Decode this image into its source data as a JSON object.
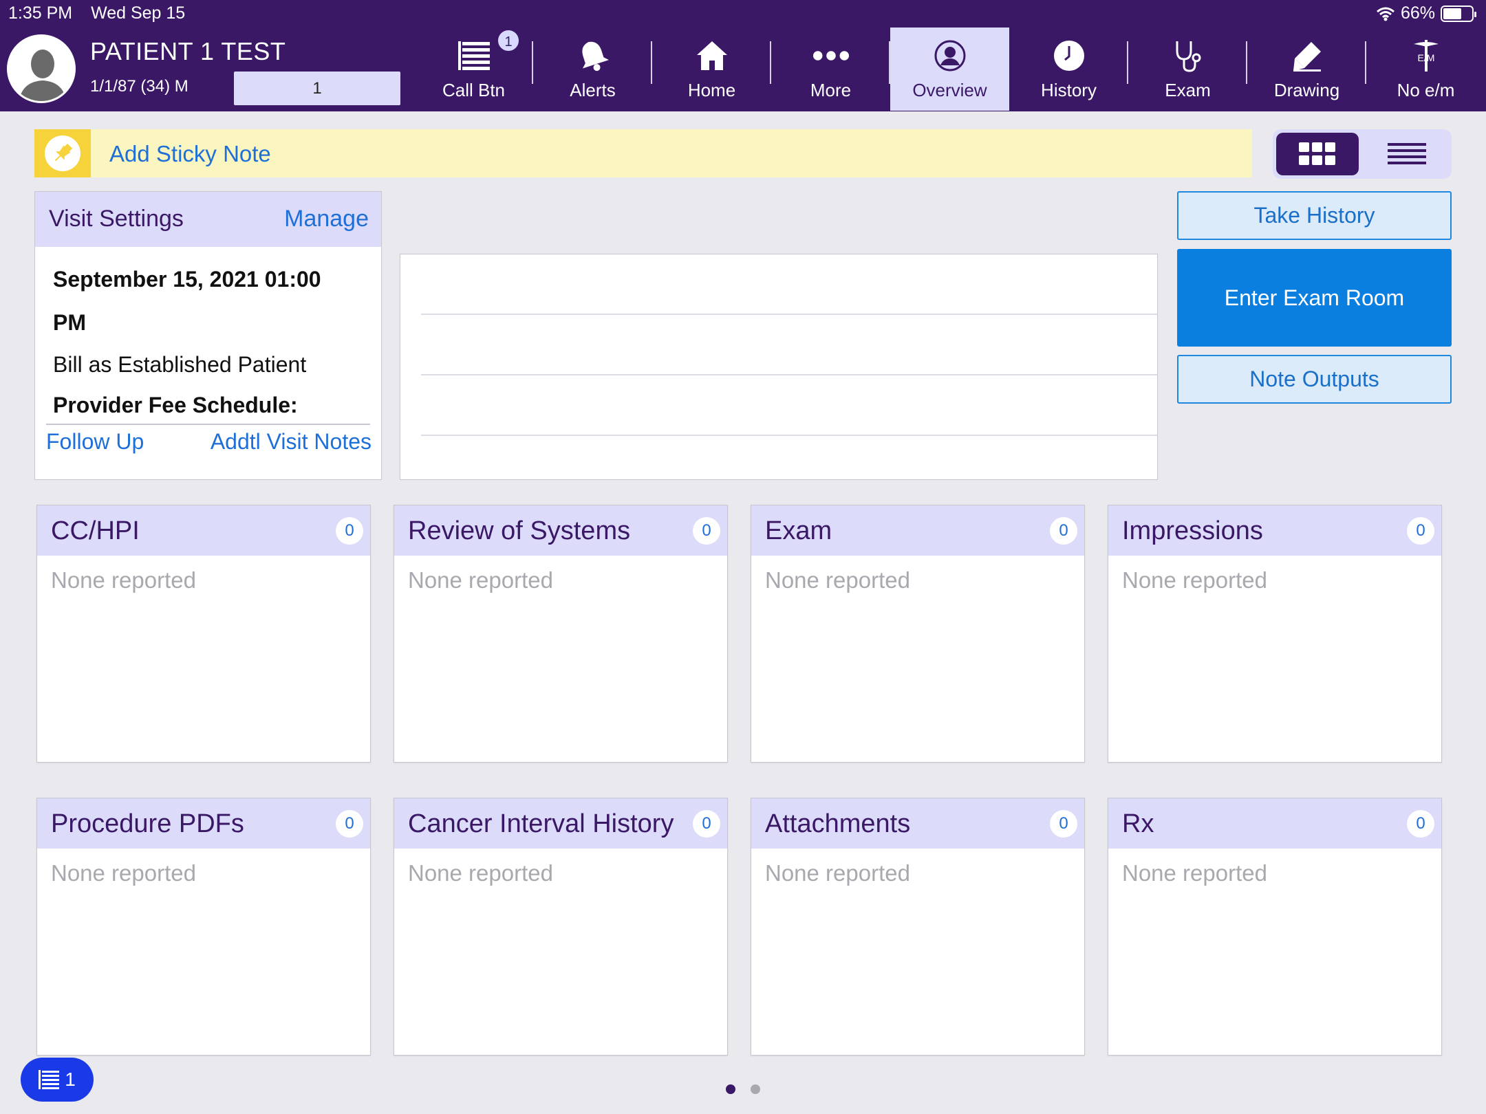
{
  "status_bar": {
    "time": "1:35 PM",
    "date": "Wed Sep 15",
    "battery": "66%",
    "battery_level": 0.66
  },
  "patient": {
    "name": "PATIENT 1 TEST",
    "dob_age_sex": "1/1/87 (34) M",
    "field_value": "1"
  },
  "nav": {
    "items": [
      {
        "label": "Call Btn",
        "icon": "list-icon",
        "badge": "1"
      },
      {
        "label": "Alerts",
        "icon": "bell-icon"
      },
      {
        "label": "Home",
        "icon": "home-icon"
      },
      {
        "label": "More",
        "icon": "more-icon"
      },
      {
        "label": "Overview",
        "icon": "person-icon",
        "active": true
      },
      {
        "label": "History",
        "icon": "clock-icon"
      },
      {
        "label": "Exam",
        "icon": "stethoscope-icon"
      },
      {
        "label": "Drawing",
        "icon": "pencil-icon"
      },
      {
        "label": "No e/m",
        "icon": "caduceus-icon",
        "icon_text": "E/M"
      }
    ]
  },
  "sticky_note": {
    "label": "Add Sticky Note"
  },
  "visit_settings": {
    "title": "Visit Settings",
    "manage": "Manage",
    "datetime_line1": "September 15, 2021 01:00",
    "datetime_line2": "PM",
    "billing": "Bill as Established Patient",
    "fee_schedule": "Provider Fee Schedule:",
    "follow_up": "Follow Up",
    "addtl_notes": "Addtl Visit Notes"
  },
  "actions": {
    "take_history": "Take History",
    "enter_exam_room": "Enter Exam Room",
    "note_outputs": "Note Outputs"
  },
  "sections": [
    {
      "title": "CC/HPI",
      "count": "0",
      "empty": "None reported"
    },
    {
      "title": "Review of Systems",
      "count": "0",
      "empty": "None reported"
    },
    {
      "title": "Exam",
      "count": "0",
      "empty": "None reported"
    },
    {
      "title": "Impressions",
      "count": "0",
      "empty": "None reported"
    },
    {
      "title": "Procedure PDFs",
      "count": "0",
      "empty": "None reported"
    },
    {
      "title": "Cancer Interval History",
      "count": "0",
      "empty": "None reported"
    },
    {
      "title": "Attachments",
      "count": "0",
      "empty": "None reported"
    },
    {
      "title": "Rx",
      "count": "0",
      "empty": "None reported"
    }
  ],
  "floating_button": {
    "count": "1"
  },
  "pager": {
    "pages": 2,
    "current": 1
  },
  "colors": {
    "header": "#3b1866",
    "accent_light": "#dcdcfa",
    "link": "#1f6fd8",
    "primary_button": "#0b7fe0",
    "sticky": "#fbf5c0"
  }
}
